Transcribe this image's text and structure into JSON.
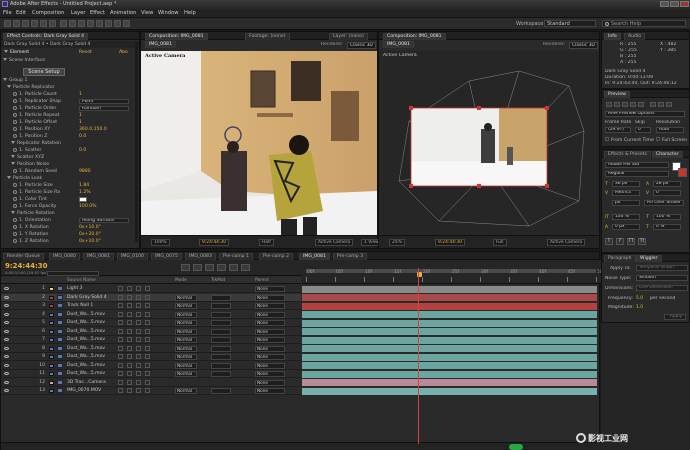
{
  "app": {
    "title": "Adobe After Effects - Untitled Project.aep *",
    "menu": [
      "File",
      "Edit",
      "Composition",
      "Layer",
      "Effect",
      "Animation",
      "View",
      "Window",
      "Help"
    ]
  },
  "toolbar": {
    "workspace_label": "Workspace:",
    "workspace_value": "Standard",
    "search_placeholder": "Search Help"
  },
  "effect_controls": {
    "tabs": [
      "Effect Controls: Dark Gray Solid 4"
    ],
    "header": "Dark Gray Solid 4 • Dark Gray Solid 4",
    "effect_name": "Element",
    "reset": "Reset",
    "about": "Abo",
    "rows": [
      {
        "label": "Scene Interface",
        "indent": 2
      },
      {
        "label": "Group 1",
        "indent": 2
      },
      {
        "label": "Particle Replicator",
        "indent": 6
      },
      {
        "label": "1. Particle Count",
        "indent": 12,
        "value": "1"
      },
      {
        "label": "1. Replicator Shap",
        "indent": 12,
        "select": "Point"
      },
      {
        "label": "1. Particle Order",
        "indent": 12,
        "select": "Random"
      },
      {
        "label": "1. Particle Repeat",
        "indent": 12,
        "value": "1"
      },
      {
        "label": "1. Particle Offset",
        "indent": 12,
        "value": "1"
      },
      {
        "label": "1. Position XY",
        "indent": 12,
        "value": "360.0,150.0"
      },
      {
        "label": "1. Position Z",
        "indent": 12,
        "value": "0.0"
      },
      {
        "label": "Replicator Rotation",
        "indent": 10
      },
      {
        "label": "1. Scatter",
        "indent": 12,
        "value": "0.0"
      },
      {
        "label": "Scatter XYZ",
        "indent": 10
      },
      {
        "label": "Position Noise",
        "indent": 10
      },
      {
        "label": "1. Random Seed",
        "indent": 12,
        "value": "9880"
      },
      {
        "label": "Particle Look",
        "indent": 6
      },
      {
        "label": "1. Particle Size",
        "indent": 12,
        "value": "1.84"
      },
      {
        "label": "1. Particle Size Ra",
        "indent": 12,
        "value": "1.2%"
      },
      {
        "label": "1. Color Tint",
        "indent": 12,
        "swatch": true
      },
      {
        "label": "1. Force Opacity",
        "indent": 12,
        "value": "100.0%"
      },
      {
        "label": "Particle Rotation",
        "indent": 10
      },
      {
        "label": "1. Orientation",
        "indent": 12,
        "select": "Along Surface"
      },
      {
        "label": "1. X Rotation",
        "indent": 12,
        "value": "0x+10.0°"
      },
      {
        "label": "1. Y Rotation",
        "indent": 12,
        "value": "0x+20.0°"
      },
      {
        "label": "1. Z Rotation",
        "indent": 12,
        "value": "0x+10.0°"
      }
    ],
    "scene_setup": "Scene Setup"
  },
  "composition": {
    "tabs": [
      "Composition: IMG_0081",
      "Footage: (none)",
      "Layer: (none)"
    ],
    "sub_tab": "IMG_0081",
    "renderer_label": "Renderer:",
    "renderer_value": "Classic 3D",
    "active_camera_label": "Active Camera",
    "zoom": "100%",
    "timecode": "9:24:44:30",
    "resolution": "Half",
    "view": "Active Camera",
    "views": "1 View"
  },
  "viewer2": {
    "tabs": [
      "Composition: IMG_0081"
    ],
    "sub_tab": "IMG_0081",
    "renderer_label": "Renderer:",
    "renderer_value": "Classic 3D",
    "camera_label": "Active Camera",
    "zoom": "25%",
    "timecode": "9:24:44:30",
    "resolution": "Full",
    "view": "Active Camera"
  },
  "info": {
    "tabs": [
      "Info",
      "Audio"
    ],
    "r": "R : 255",
    "g": "G : 255",
    "b": "B : 255",
    "a": "A : 255",
    "x": "X : 482",
    "y": "Y : 385",
    "layer": "Dark Gray Solid 4",
    "duration": "Duration: 0:00:11:09",
    "inout": "In: 9:24:43:40, Out: 9:24:46:12"
  },
  "preview": {
    "title": "Preview",
    "ram_options": "RAM Preview Options",
    "frame_rate_label": "Frame Rate",
    "skip_label": "Skip",
    "resolution_label": "Resolution",
    "frame_rate": "(29.97)",
    "skip": "0",
    "resolution": "Auto",
    "from_current": "From Current Time",
    "full_screen": "Full Screen"
  },
  "character": {
    "tabs": [
      "Effects & Presets",
      "Character"
    ],
    "font": "Adobe Hei Std",
    "style": "Regular",
    "size": "36 px",
    "leading": "28 px",
    "kerning": "Metrics",
    "tracking": "0",
    "stroke_width": "px",
    "stroke_type": "Fill Over Stroke",
    "v_scale": "100 %",
    "h_scale": "100 %",
    "baseline": "0 px",
    "tsume": "0 %"
  },
  "timeline": {
    "tabs": [
      "Render Queue",
      "IMG_0080",
      "IMG_0081",
      "IMG_0100",
      "IMG_0075",
      "IMG_0083",
      "Pre-comp 1",
      "Pre-comp 2",
      "IMG_0081",
      "Pre-comp 3"
    ],
    "timecode": "9:24:44:30",
    "timecode_sub": "0:00:10:00 (29.97 fps)",
    "col_source": "Source Name",
    "col_mode": "Mode",
    "col_trkmat": "TrkMat",
    "col_parent": "Parent",
    "ruler_labels": [
      "00f",
      "05f",
      "10f",
      "15f",
      "20f",
      "25f",
      "30f",
      "35f",
      "40f",
      "45f",
      "50f"
    ],
    "cti_fraction": 0.39,
    "layers": [
      {
        "num": "1",
        "name": "Light 3",
        "color": "#f2d27a",
        "mode": "",
        "parent": "None",
        "bar": "#8a8a8a",
        "selected": false
      },
      {
        "num": "2",
        "name": "Dark Gray Solid 4",
        "color": "#b33b3b",
        "mode": "Normal",
        "parent": "None",
        "bar": "#a84a48",
        "selected": true
      },
      {
        "num": "3",
        "name": "Track Null 1",
        "color": "#b33b3b",
        "mode": "Normal",
        "parent": "None",
        "bar": "#b34242",
        "selected": false
      },
      {
        "num": "4",
        "name": "Dust_Wa...5.mov",
        "color": "#5f7fa8",
        "mode": "Normal",
        "parent": "None",
        "bar": "#6aa5a0",
        "selected": false
      },
      {
        "num": "5",
        "name": "Dust_Wa...5.mov",
        "color": "#5f7fa8",
        "mode": "Normal",
        "parent": "None",
        "bar": "#6aa5a0",
        "selected": false
      },
      {
        "num": "6",
        "name": "Dust_Wa...5.mov",
        "color": "#5f7fa8",
        "mode": "Normal",
        "parent": "None",
        "bar": "#6aa5a0",
        "selected": false
      },
      {
        "num": "7",
        "name": "Dust_Wa...5.mov",
        "color": "#5f7fa8",
        "mode": "Normal",
        "parent": "None",
        "bar": "#6aa5a0",
        "selected": false
      },
      {
        "num": "8",
        "name": "Dust_Wa...5.mov",
        "color": "#5f7fa8",
        "mode": "Normal",
        "parent": "None",
        "bar": "#6aa5a0",
        "selected": false
      },
      {
        "num": "9",
        "name": "Dust_Wa...5.mov",
        "color": "#5f7fa8",
        "mode": "Normal",
        "parent": "None",
        "bar": "#6aa5a0",
        "selected": false
      },
      {
        "num": "10",
        "name": "Dust_Wa...5.mov",
        "color": "#5f7fa8",
        "mode": "Normal",
        "parent": "None",
        "bar": "#6aa5a0",
        "selected": false
      },
      {
        "num": "11",
        "name": "Dust_Wa...5.mov",
        "color": "#5f7fa8",
        "mode": "Normal",
        "parent": "None",
        "bar": "#6aa5a0",
        "selected": false
      },
      {
        "num": "12",
        "name": "3D Trac...Camera",
        "color": "#d9a0b8",
        "mode": "",
        "parent": "None",
        "bar": "#b88a98",
        "selected": false
      },
      {
        "num": "13",
        "name": "IMG_0070.MOV",
        "color": "#5f7fa8",
        "mode": "Normal",
        "parent": "None",
        "bar": "#78b0ad",
        "selected": false
      }
    ]
  },
  "paragraph": {
    "tabs": [
      "Paragraph",
      "Wiggler"
    ],
    "apply_to_label": "Apply To:",
    "apply_to": "Temporal Graph",
    "noise_label": "Noise Type:",
    "noise": "Smooth",
    "dimensions_label": "Dimensions:",
    "dimensions": "One Dimension",
    "frequency_label": "Frequency:",
    "frequency": "5.0",
    "frequency_unit": "per second",
    "magnitude_label": "Magnitude:",
    "magnitude": "1.0",
    "apply": "Apply"
  },
  "overlay": {
    "particle_label": "Active Camera",
    "watermark": "影视工业网"
  }
}
